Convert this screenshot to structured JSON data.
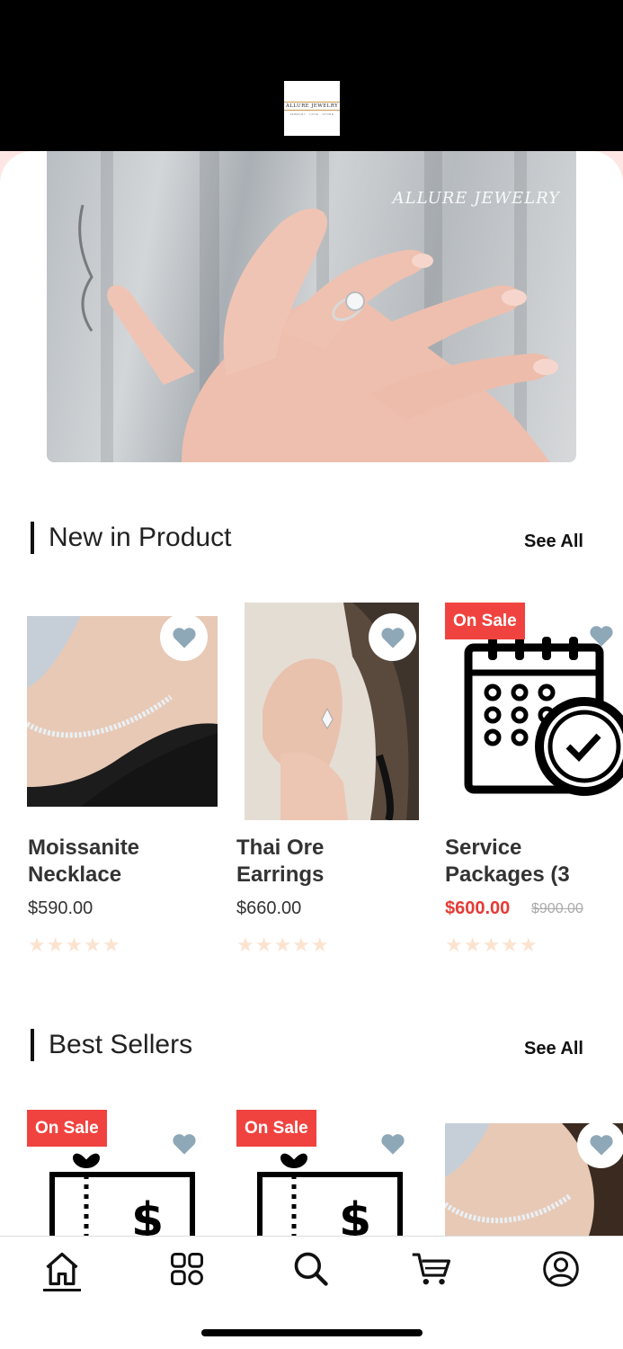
{
  "header": {
    "logo_text": "ALLURE JEWELRY",
    "logo_sub": "JEWELRY · LOVE · STORE"
  },
  "hero": {
    "watermark": "ALLURE JEWELRY"
  },
  "sections": {
    "new_in": {
      "title": "New in Product",
      "see_all": "See All",
      "products": [
        {
          "name_line1": "Moissanite",
          "name_line2": "Necklace",
          "price": "$590.00",
          "stars": "★★★★★"
        },
        {
          "name_line1": "Thai Ore",
          "name_line2": "Earrings",
          "price": "$660.00",
          "stars": "★★★★★"
        },
        {
          "name_line1": "Service",
          "name_line2": "Packages (3",
          "price": "$600.00",
          "old_price": "$900.00",
          "badge": "On Sale",
          "stars": "★★★★★"
        }
      ]
    },
    "best_sellers": {
      "title": "Best Sellers",
      "see_all": "See All",
      "products": [
        {
          "badge": "On Sale"
        },
        {
          "badge": "On Sale"
        },
        {}
      ]
    }
  },
  "colors": {
    "sale_badge": "#f0433f",
    "heart": "#8fa8b8",
    "star": "#fbe3d0",
    "accent_pink": "#fde6e4"
  },
  "tabbar": {
    "items": [
      "home-icon",
      "categories-icon",
      "search-icon",
      "cart-icon",
      "profile-icon"
    ],
    "active": "home-icon"
  }
}
